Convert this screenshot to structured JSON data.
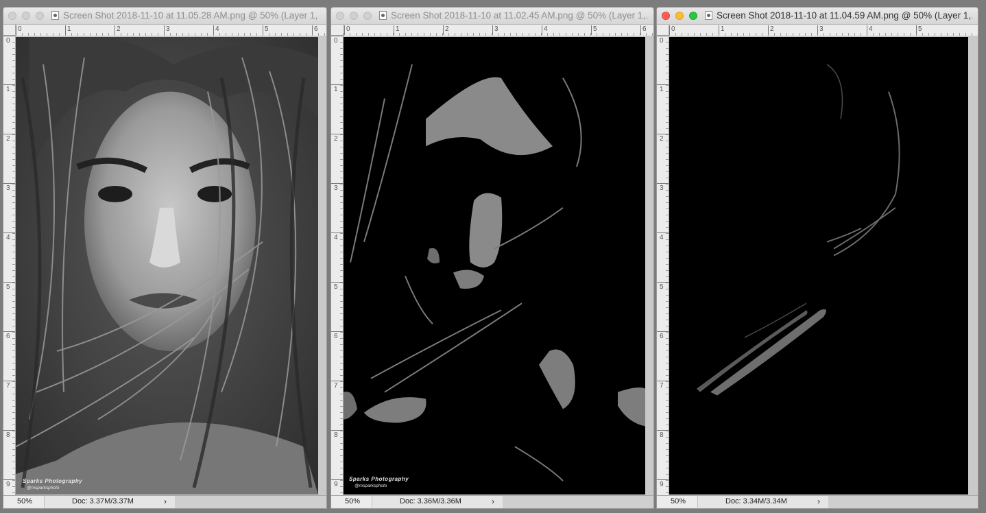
{
  "windows": [
    {
      "title": "Screen Shot 2018-11-10 at 11.05.28 AM.png @ 50% (Layer 1, R...",
      "zoom": "50%",
      "doc_info": "Doc: 3.37M/3.37M",
      "active": false
    },
    {
      "title": "Screen Shot 2018-11-10 at 11.02.45 AM.png @ 50% (Layer 1,...",
      "zoom": "50%",
      "doc_info": "Doc: 3.36M/3.36M",
      "active": false
    },
    {
      "title": "Screen Shot 2018-11-10 at 11.04.59 AM.png @ 50% (Layer 1,...",
      "zoom": "50%",
      "doc_info": "Doc: 3.34M/3.34M",
      "active": true
    }
  ],
  "ruler_labels_h": [
    "0",
    "1",
    "2",
    "3",
    "4",
    "5",
    "6"
  ],
  "ruler_labels_v": [
    "0",
    "1",
    "2",
    "3",
    "4",
    "5",
    "6",
    "7",
    "8",
    "9"
  ],
  "watermark": {
    "name": "Sparks Photography",
    "handle": "@msparksphoto"
  },
  "status_arrow": "›",
  "colors": {
    "light_close": "#fe5f57",
    "light_minimize": "#febc2e",
    "light_zoom": "#28c840"
  }
}
